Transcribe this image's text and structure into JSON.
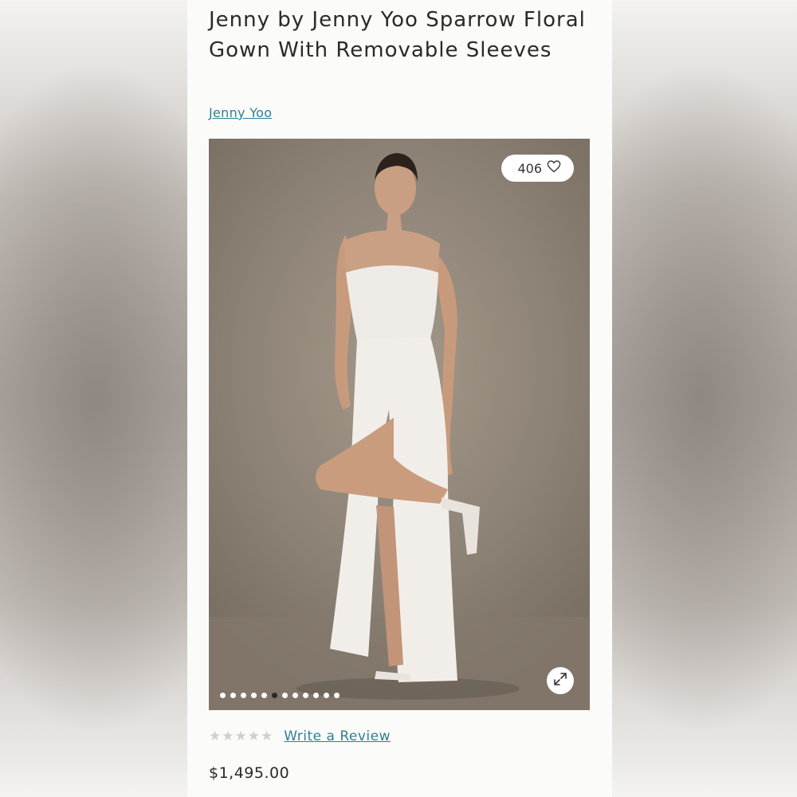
{
  "product": {
    "title": "Jenny by Jenny Yoo Sparrow Floral Gown With Removable Sleeves",
    "brand_link": "Jenny Yoo",
    "price": "$1,495.00"
  },
  "gallery": {
    "like_count": "406",
    "like_icon": "heart-icon",
    "expand_icon": "expand-arrows-icon",
    "image_count": 12,
    "active_index": 5
  },
  "reviews": {
    "star_rating": 0,
    "max_stars": 5,
    "write_review_label": "Write a Review"
  },
  "colors": {
    "link": "#2f7f95",
    "text": "#2a2a2a",
    "star_empty": "#cfcfcf"
  }
}
